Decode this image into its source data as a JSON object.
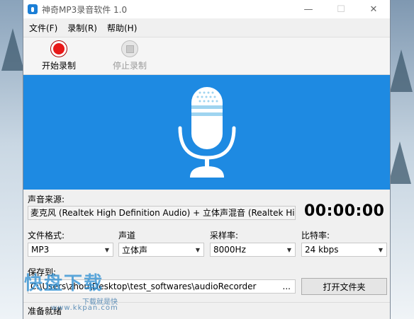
{
  "window": {
    "title": "神奇MP3录音软件 1.0",
    "controls": {
      "minimize": "—",
      "maximize": "☐",
      "close": "✕"
    }
  },
  "menu": [
    {
      "label": "文件(F)"
    },
    {
      "label": "录制(R)"
    },
    {
      "label": "帮助(H)"
    }
  ],
  "toolbar": {
    "start_label": "开始录制",
    "stop_label": "停止录制"
  },
  "banner": {
    "icon": "microphone-icon",
    "color": "#1e8ae2"
  },
  "source": {
    "label": "声音来源:",
    "value": "麦克风 (Realtek High Definition Audio) + 立体声混音 (Realtek Hig ..."
  },
  "timer": "00:00:00",
  "settings": {
    "format": {
      "label": "文件格式:",
      "value": "MP3"
    },
    "channel": {
      "label": "声道",
      "value": "立体声"
    },
    "sample_rate": {
      "label": "采样率:",
      "value": "8000Hz"
    },
    "bitrate": {
      "label": "比特率:",
      "value": "24 kbps"
    }
  },
  "save": {
    "label": "保存到:",
    "path": "C:\\Users\\zhou\\Desktop\\test_softwares\\audioRecorder",
    "browse": "...",
    "open_folder": "打开文件夹"
  },
  "status": "准备就绪",
  "watermark": {
    "brand": "快盘下载",
    "slogan": "下载就是快",
    "url": "www.kkpan.com"
  }
}
